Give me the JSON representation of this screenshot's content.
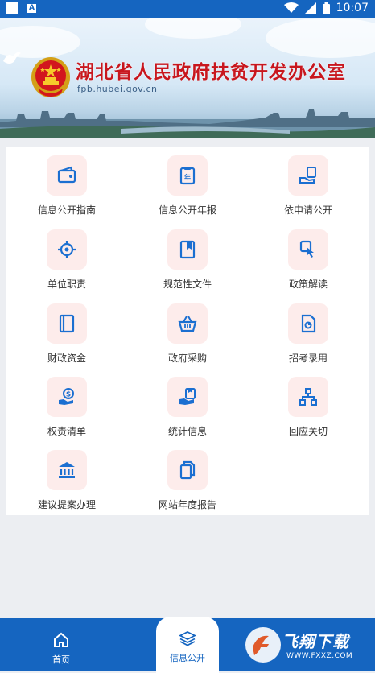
{
  "status_bar": {
    "time": "10:07",
    "notification_letter": "A"
  },
  "banner": {
    "title": "湖北省人民政府扶贫开发办公室",
    "url": "fpb.hubei.gov.cn"
  },
  "grid": {
    "items": [
      {
        "label": "信息公开指南",
        "icon": "wallet-icon"
      },
      {
        "label": "信息公开年报",
        "icon": "annual-report-icon"
      },
      {
        "label": "依申请公开",
        "icon": "application-hand-icon"
      },
      {
        "label": "单位职责",
        "icon": "target-icon"
      },
      {
        "label": "规范性文件",
        "icon": "bookmark-book-icon"
      },
      {
        "label": "政策解读",
        "icon": "policy-click-icon"
      },
      {
        "label": "财政资金",
        "icon": "ledger-icon"
      },
      {
        "label": "政府采购",
        "icon": "basket-icon"
      },
      {
        "label": "招考录用",
        "icon": "exam-document-icon"
      },
      {
        "label": "权责清单",
        "icon": "money-hand-icon"
      },
      {
        "label": "统计信息",
        "icon": "statistics-hand-icon"
      },
      {
        "label": "回应关切",
        "icon": "hierarchy-icon"
      },
      {
        "label": "建议提案办理",
        "icon": "institution-icon"
      },
      {
        "label": "网站年度报告",
        "icon": "copy-documents-icon"
      }
    ]
  },
  "bottom_nav": {
    "home_label": "首页",
    "info_label": "信息公开",
    "active": "信息公开"
  },
  "watermark": {
    "text": "飞翔下载",
    "url": "WWW.FXXZ.COM"
  },
  "colors": {
    "primary": "#1565c0",
    "icon_blue": "#1b6fd1",
    "tile_bg": "#fdeceb",
    "title_red": "#c8171e"
  }
}
